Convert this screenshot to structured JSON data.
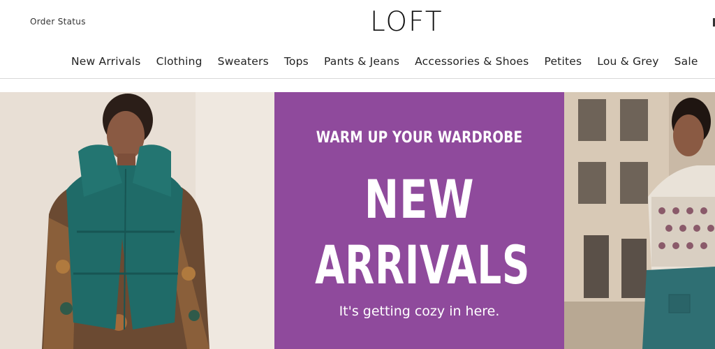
{
  "header": {
    "order_status": "Order Status",
    "logo": "LOFT"
  },
  "nav": [
    "New Arrivals",
    "Clothing",
    "Sweaters",
    "Tops",
    "Pants & Jeans",
    "Accessories & Shoes",
    "Petites",
    "Lou & Grey",
    "Sale"
  ],
  "hero": {
    "eyebrow": "WARM UP YOUR WARDROBE",
    "line1": "NEW",
    "line2": "ARRIVALS",
    "subtitle": "It's getting cozy in here.",
    "panel_color": "#8f4a9c"
  }
}
